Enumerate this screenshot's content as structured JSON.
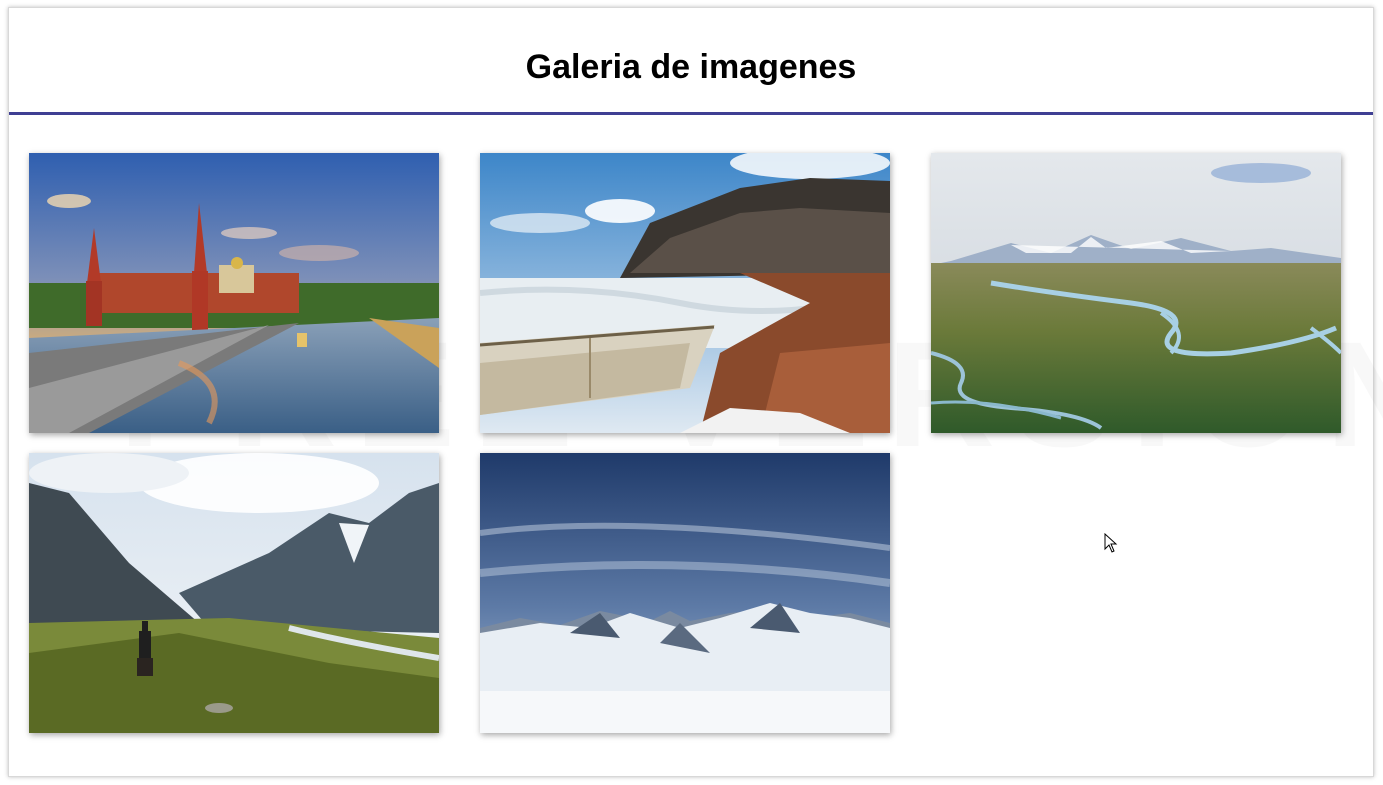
{
  "page": {
    "title": "Galeria de imagenes"
  },
  "gallery": {
    "images": [
      {
        "subject": "moscow-kremlin-river"
      },
      {
        "subject": "frozen-lake-boat"
      },
      {
        "subject": "river-valley-aerial"
      },
      {
        "subject": "mountain-valley-rider"
      },
      {
        "subject": "snowy-mountain-range"
      }
    ]
  },
  "colors": {
    "header_rule": "#3f3f93",
    "background": "#ffffff",
    "title": "#000000"
  }
}
